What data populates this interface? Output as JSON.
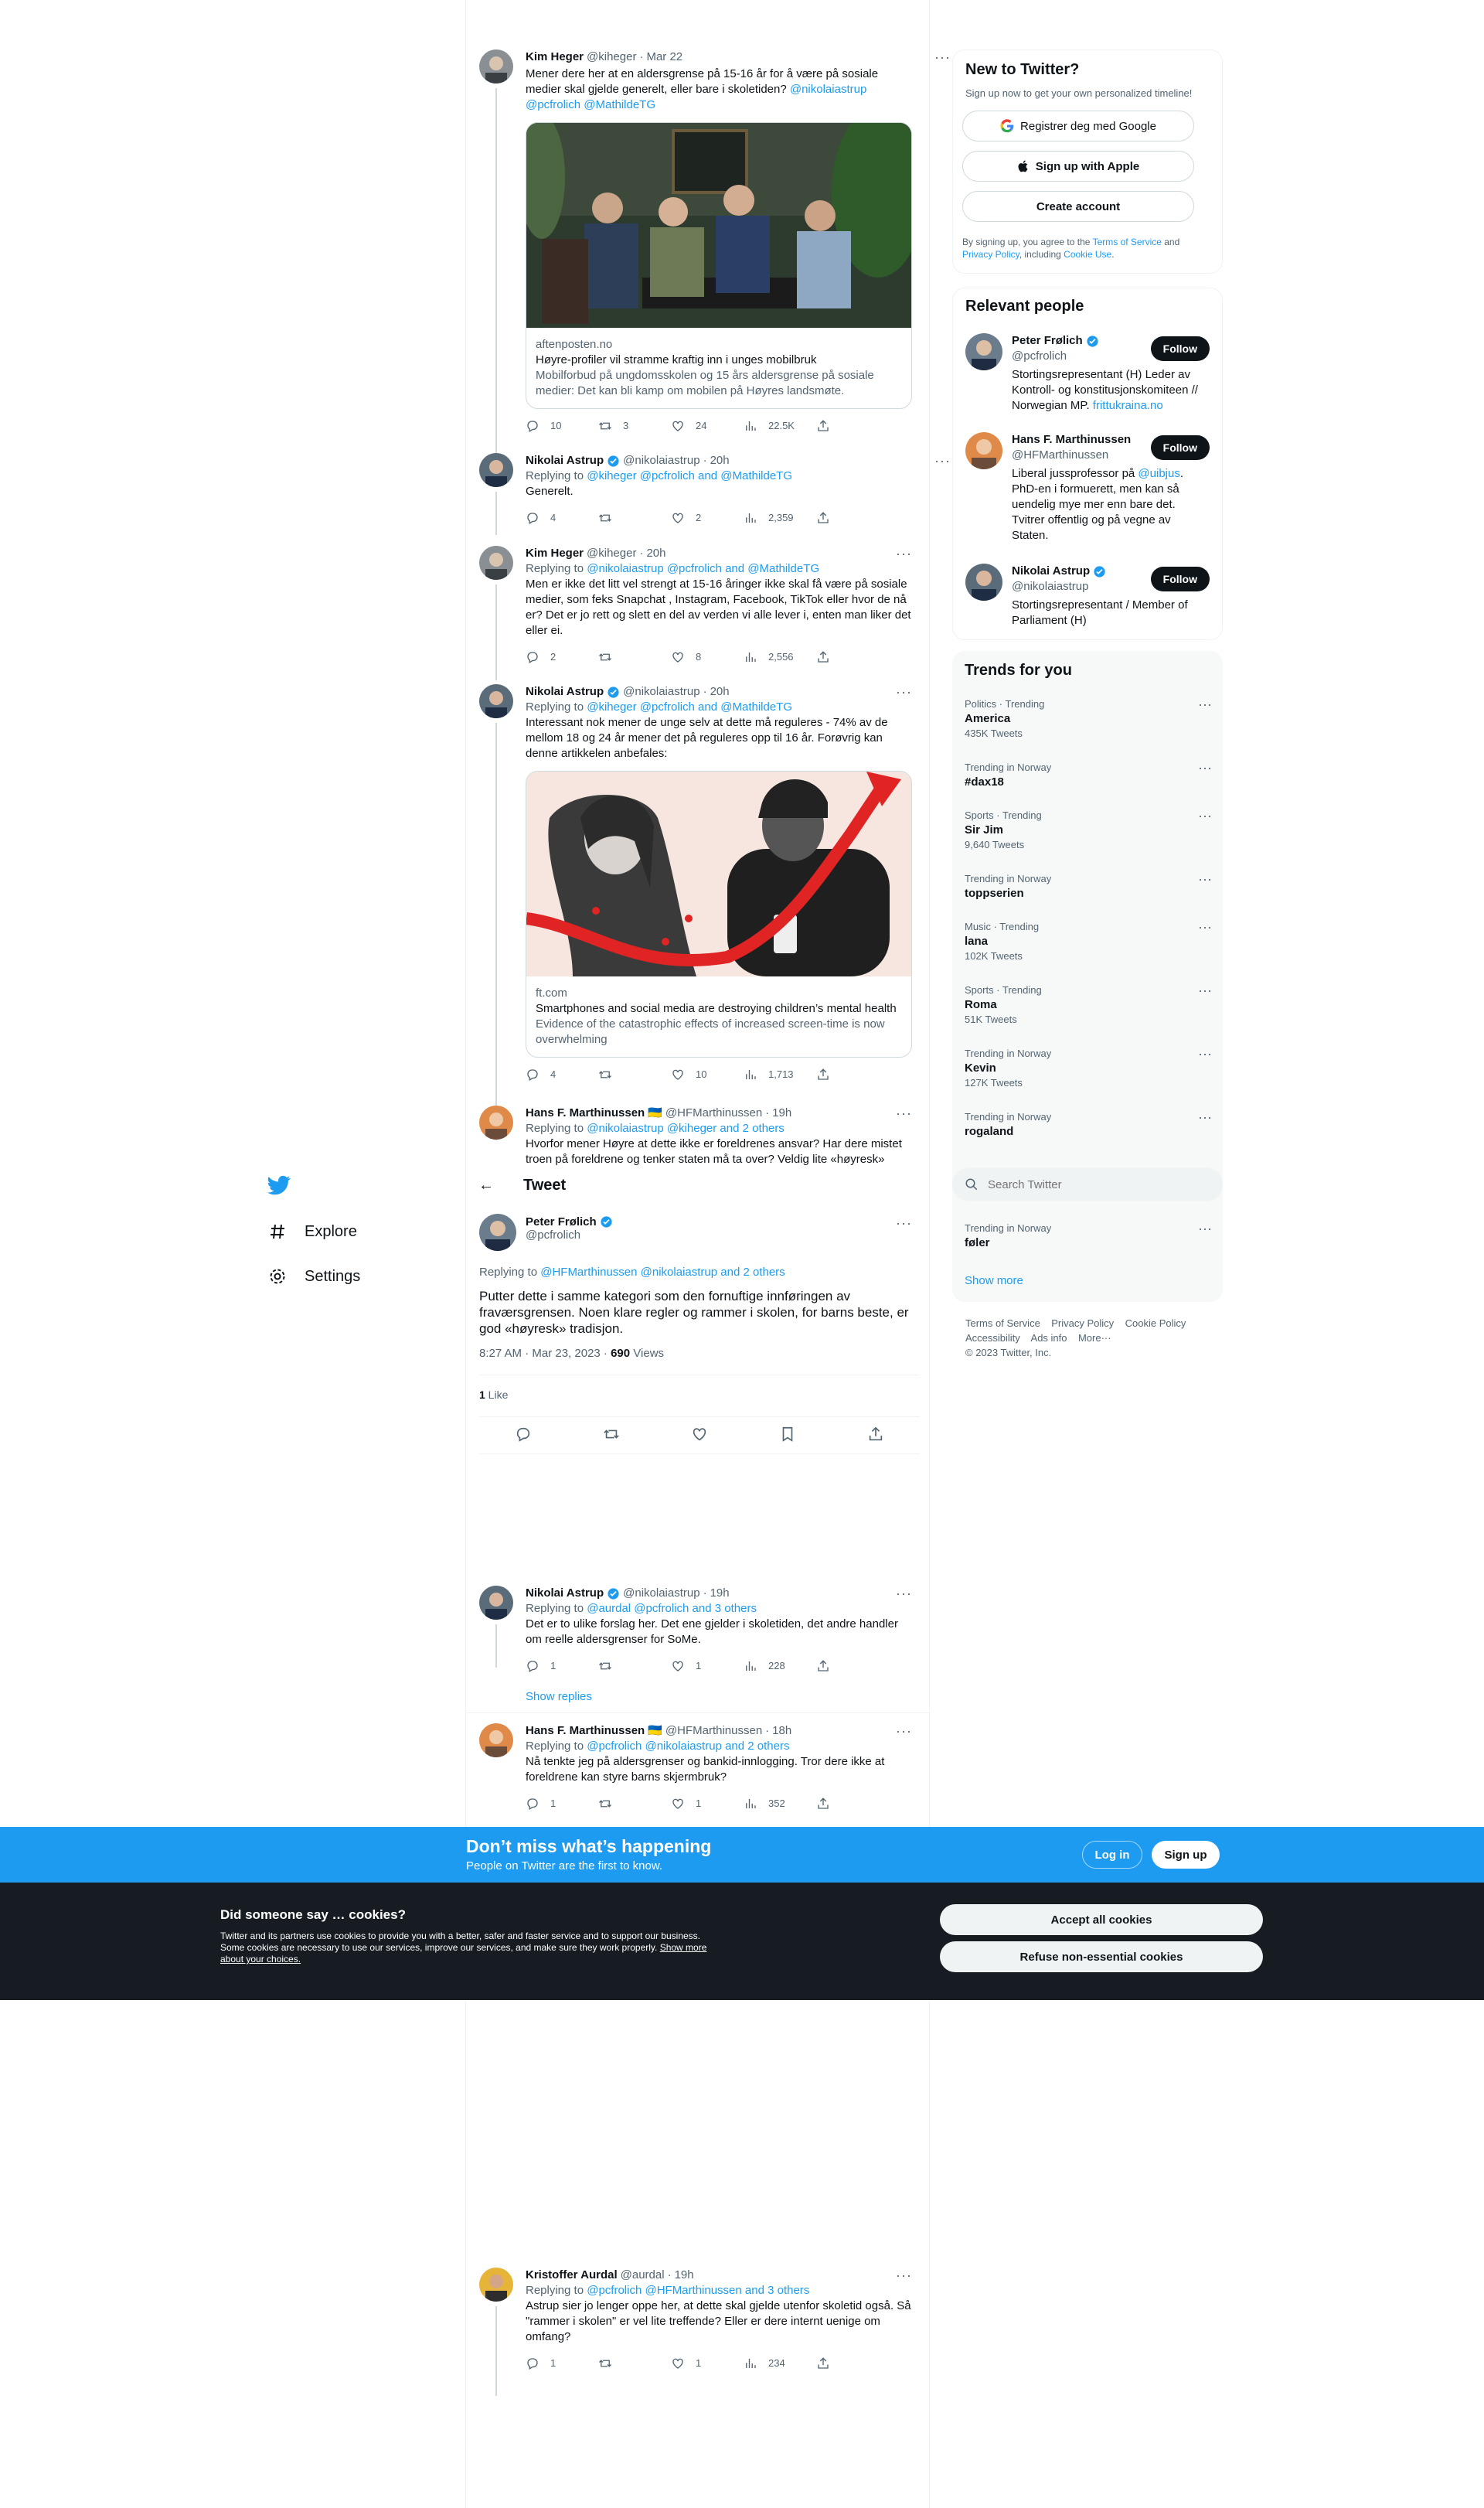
{
  "nav": {
    "explore": "Explore",
    "settings": "Settings"
  },
  "main_header": {
    "title": "Tweet"
  },
  "tweets": [
    {
      "name": "Kim Heger",
      "handle": "@kiheger",
      "time": "Mar 22",
      "text_start": "Mener dere her at en aldersgrense på 15-16 år for å være på sosiale medier skal gjelde generelt, eller bare i skoletiden? ",
      "mentions": "@nikolaiastrup @pcfrolich @MathildeTG",
      "card": {
        "domain": "aftenposten.no",
        "title": "Høyre-profiler vil stramme kraftig inn i unges mobilbruk",
        "desc": "Mobilforbud på ungdomsskolen og 15 års aldersgrense på sosiale medier: Det kan bli kamp om mobilen på Høyres landsmøte."
      },
      "replies": "10",
      "retweets": "3",
      "likes": "24",
      "views": "22.5K"
    },
    {
      "name": "Nikolai Astrup",
      "handle": "@nikolaiastrup",
      "time": "20h",
      "replying_label": "Replying to ",
      "replying_to": "@kiheger @pcfrolich and @MathildeTG",
      "text": "Generelt.",
      "replies": "4",
      "retweets": "",
      "likes": "2",
      "views": "2,359"
    },
    {
      "name": "Kim Heger",
      "handle": "@kiheger",
      "time": "20h",
      "replying_label": "Replying to ",
      "replying_to": "@nikolaiastrup @pcfrolich and @MathildeTG",
      "text": "Men er ikke det litt vel strengt at 15-16 åringer ikke skal få være på sosiale medier, som feks Snapchat , Instagram, Facebook, TikTok eller hvor de nå er? Det er jo rett og slett en del av verden vi alle lever i, enten man liker det eller ei.",
      "replies": "2",
      "retweets": "",
      "likes": "8",
      "views": "2,556"
    },
    {
      "name": "Nikolai Astrup",
      "handle": "@nikolaiastrup",
      "time": "20h",
      "replying_label": "Replying to ",
      "replying_to": "@kiheger @pcfrolich and @MathildeTG",
      "text": "Interessant nok mener de unge selv at dette må reguleres - 74% av de mellom 18 og 24 år mener det på reguleres opp til 16 år. Forøvrig kan denne artikkelen anbefales:",
      "card": {
        "domain": "ft.com",
        "title": "Smartphones and social media are destroying children’s mental health",
        "desc": "Evidence of the catastrophic effects of increased screen-time is now overwhelming"
      },
      "replies": "4",
      "retweets": "",
      "likes": "10",
      "views": "1,713"
    },
    {
      "name": "Hans F. Marthinussen",
      "flag": "🇺🇦",
      "handle": "@HFMarthinussen",
      "time": "19h",
      "replying_label": "Replying to ",
      "replying_to": "@nikolaiastrup @kiheger and 2 others",
      "text": "Hvorfor mener Høyre at dette ikke er foreldrenes ansvar? Har dere mistet troen på foreldrene og tenker staten må ta over? Veldig lite «høyresk»"
    }
  ],
  "focal": {
    "name": "Peter Frølich",
    "handle": "@pcfrolich",
    "replying_label": "Replying to ",
    "replying_to": "@HFMarthinussen @nikolaiastrup and 2 others",
    "text": "Putter dette i samme kategori som den fornuftige innføringen av fraværsgrensen. Noen klare regler og rammer i skolen, for barns beste, er god «høyresk» tradisjon.",
    "timestamp": "8:27 AM · Mar 23, 2023 · ",
    "views_count": "690",
    "views_label": " Views",
    "likes_count": "1",
    "likes_label": " Like"
  },
  "replies": [
    {
      "name": "Nikolai Astrup",
      "handle": "@nikolaiastrup",
      "time": "19h",
      "replying_label": "Replying to ",
      "replying_to": "@aurdal @pcfrolich and 3 others",
      "text": "Det er to ulike forslag her. Det ene gjelder i skoletiden, det andre handler om reelle aldersgrenser for SoMe.",
      "replies": "1",
      "retweets": "",
      "likes": "1",
      "views": "228",
      "show_replies": "Show replies"
    },
    {
      "name": "Hans F. Marthinussen",
      "flag": "🇺🇦",
      "handle": "@HFMarthinussen",
      "time": "18h",
      "replying_label": "Replying to ",
      "replying_to": "@pcfrolich @nikolaiastrup and 2 others",
      "text": "Nå tenkte jeg på aldersgrenser og bankid-innlogging. Tror dere ikke at foreldrene kan styre barns skjermbruk?",
      "replies": "1",
      "retweets": "",
      "likes": "1",
      "views": "352"
    },
    {
      "name": "Kristoffer Aurdal",
      "handle": "@aurdal",
      "time": "19h",
      "replying_label": "Replying to ",
      "replying_to": "@pcfrolich @HFMarthinussen and 3 others",
      "text": "Astrup sier jo lenger oppe her, at dette skal gjelde utenfor skoletid også. Så \"rammer i skolen\" er vel lite treffende? Eller er dere internt uenige om omfang?",
      "replies": "1",
      "retweets": "",
      "likes": "1",
      "views": "234"
    }
  ],
  "signup": {
    "title": "New to Twitter?",
    "subtitle": "Sign up now to get your own personalized timeline!",
    "google": "Registrer deg med Google",
    "apple": "Sign up with Apple",
    "create": "Create account",
    "legal_1": "By signing up, you agree to the ",
    "terms": "Terms of Service",
    "legal_2": " and ",
    "privacy": "Privacy Policy",
    "legal_3": ", including ",
    "cookie": "Cookie Use",
    "legal_4": "."
  },
  "relevant": {
    "title": "Relevant people",
    "follow": "Follow",
    "people": [
      {
        "name": "Peter Frølich",
        "handle": "@pcfrolich",
        "bio": "Stortingsrepresentant (H) Leder av Kontroll- og konstitusjonskomiteen // Norwegian MP. ",
        "link": "frittukraina.no"
      },
      {
        "name": "Hans F. Marthinussen",
        "handle": "@HFMarthinussen",
        "bio_1": "Liberal jussprofessor på ",
        "link": "@uibjus",
        "bio_2": ". PhD-en i formuerett, men kan så uendelig mye mer enn bare det. Tvitrer offentlig og på vegne av Staten."
      },
      {
        "name": "Nikolai Astrup",
        "handle": "@nikolaiastrup",
        "bio": "Stortingsrepresentant / Member of Parliament (H)"
      }
    ]
  },
  "trends": {
    "title": "Trends for you",
    "items": [
      {
        "context": "Politics · Trending",
        "name": "America",
        "count": "435K Tweets"
      },
      {
        "context": "Trending in Norway",
        "name": "#dax18",
        "count": ""
      },
      {
        "context": "Sports · Trending",
        "name": "Sir Jim",
        "count": "9,640 Tweets"
      },
      {
        "context": "Trending in Norway",
        "name": "toppserien",
        "count": ""
      },
      {
        "context": "Music · Trending",
        "name": "lana",
        "count": "102K Tweets"
      },
      {
        "context": "Sports · Trending",
        "name": "Roma",
        "count": "51K Tweets"
      },
      {
        "context": "Trending in Norway",
        "name": "Kevin",
        "count": "127K Tweets"
      },
      {
        "context": "Trending in Norway",
        "name": "rogaland",
        "count": ""
      },
      {
        "context": "Trending in Norway",
        "name": "føler",
        "count": ""
      }
    ],
    "show_more": "Show more"
  },
  "search": {
    "placeholder": "Search Twitter"
  },
  "footer": {
    "tos": "Terms of Service",
    "privacy": "Privacy Policy",
    "cookie": "Cookie Policy",
    "accessibility": "Accessibility",
    "ads": "Ads info",
    "more": "More···",
    "copyright": "© 2023 Twitter, Inc."
  },
  "banner": {
    "title": "Don’t miss what’s happening",
    "subtitle": "People on Twitter are the first to know.",
    "login": "Log in",
    "signup": "Sign up"
  },
  "cookies": {
    "title": "Did someone say … cookies?",
    "body": "Twitter and its partners use cookies to provide you with a better, safer and faster service and to support our business. Some cookies are necessary to use our services, improve our services, and make sure they work properly. ",
    "link": "Show more about your choices.",
    "accept": "Accept all cookies",
    "refuse": "Refuse non-essential cookies"
  },
  "colors": {
    "accent": "#1d9bf0",
    "text": "#0f1419",
    "secondary": "#536471",
    "dark_banner": "#161c22"
  },
  "icons": [
    "twitter-bird-icon",
    "hashtag-icon",
    "gear-icon",
    "back-arrow-icon",
    "reply-icon",
    "retweet-icon",
    "like-icon",
    "views-icon",
    "share-icon",
    "bookmark-icon",
    "verified-badge-icon",
    "google-icon",
    "apple-icon",
    "search-icon"
  ]
}
